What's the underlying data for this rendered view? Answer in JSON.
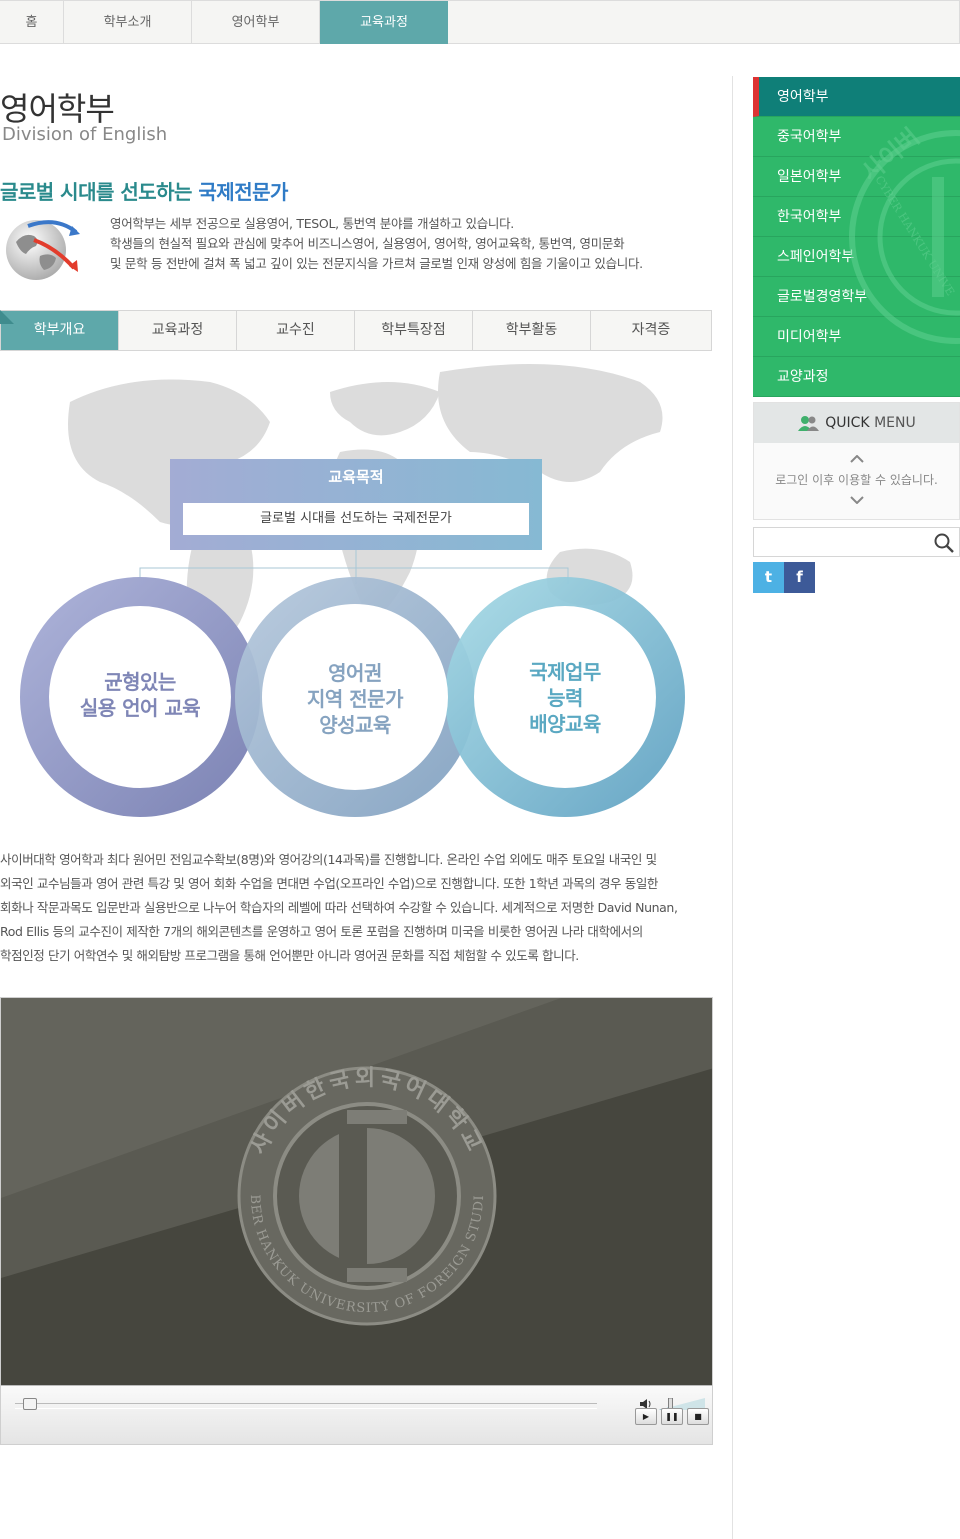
{
  "breadcrumb": [
    {
      "label": "홈",
      "active": false
    },
    {
      "label": "학부소개",
      "active": false
    },
    {
      "label": "영어학부",
      "active": false
    },
    {
      "label": "교육과정",
      "active": true
    }
  ],
  "page": {
    "title_ko": "영어학부",
    "title_en": "Division of English",
    "headline_part1": "글로벌 시대를 선도하는 ",
    "headline_part2": "국제전문가",
    "intro": [
      "영어학부는 세부 전공으로 실용영어, TESOL, 통번역 분야를 개설하고 있습니다.",
      "학생들의 현실적 필요와 관심에 맞추어 비즈니스영어, 실용영어, 영어학, 영어교육학, 통번역, 영미문화",
      "및 문학 등 전반에 걸쳐 폭 넓고 깊이 있는 전문지식을 가르쳐 글로벌 인재 양성에 힘을 기울이고 있습니다."
    ]
  },
  "tabs": [
    {
      "label": "학부개요",
      "active": true
    },
    {
      "label": "교육과정",
      "active": false
    },
    {
      "label": "교수진",
      "active": false
    },
    {
      "label": "학부특장점",
      "active": false
    },
    {
      "label": "학부활동",
      "active": false
    },
    {
      "label": "자격증",
      "active": false
    }
  ],
  "diagram": {
    "goal_title": "교육목적",
    "goal_text": "글로벌 시대를 선도하는 국제전문가",
    "circles": [
      {
        "lines": [
          "균형있는",
          "실용 언어 교육"
        ],
        "color": "#7f86b6"
      },
      {
        "lines": [
          "영어권",
          "지역 전문가",
          "양성교육"
        ],
        "color": "#86a3c0"
      },
      {
        "lines": [
          "국제업무",
          "능력",
          "배양교육"
        ],
        "color": "#5aa8c2"
      }
    ]
  },
  "body_text": [
    "사이버대학 영어학과 최다 원어민 전임교수확보(8명)와 영어강의(14과목)를 진행합니다. 온라인 수업 외에도 매주 토요일 내국인 및",
    "외국인 교수님들과 영어 관련 특강 및 영어 회화 수업을 면대면 수업(오프라인 수업)으로 진행합니다. 또한 1학년 과목의 경우 동일한",
    "회화나 작문과목도 입문반과 실용반으로 나누어 학습자의 레벨에 따라 선택하여 수강할 수 있습니다. 세계적으로 저명한 David Nunan,",
    "Rod Ellis 등의 교수진이 제작한 7개의 해외콘텐츠를 운영하고 영어 토론 포럼을 진행하며 미국을 비롯한 영어권 나라 대학에서의",
    "학점인정 단기 어학연수 및 해외탐방 프로그램을 통해 언어뿐만 아니라 영어권 문화를 직접 체험할 수 있도록 합니다."
  ],
  "video": {
    "seal_top": "사이버한국외국어대학교",
    "seal_bottom": "CYBER HANKUK UNIVERSITY OF FOREIGN STUDIES",
    "progress": 0,
    "volume": 0.25,
    "play_symbol": "▶",
    "pause_symbol": "❚❚",
    "stop_symbol": "■"
  },
  "sidebar": {
    "items": [
      {
        "label": "영어학부",
        "active": true
      },
      {
        "label": "중국어학부",
        "active": false
      },
      {
        "label": "일본어학부",
        "active": false
      },
      {
        "label": "한국어학부",
        "active": false
      },
      {
        "label": "스페인어학부",
        "active": false
      },
      {
        "label": "글로벌경영학부",
        "active": false
      },
      {
        "label": "미디어학부",
        "active": false
      },
      {
        "label": "교양과정",
        "active": false
      }
    ],
    "deco_text": "사이버",
    "deco_en": "CYBER HANKUK UNIVE",
    "quick_menu_bold": "QUICK",
    "quick_menu_rest": " MENU",
    "quick_message": "로그인 이후 이용할 수 있습니다.",
    "search_placeholder": "",
    "twitter_label": "t",
    "facebook_label": "f"
  },
  "colors": {
    "teal": "#5ea8aa",
    "green": "#2fb86a",
    "dark_teal": "#0f7f78",
    "twitter": "#4db1e4",
    "facebook": "#3d5a98"
  }
}
